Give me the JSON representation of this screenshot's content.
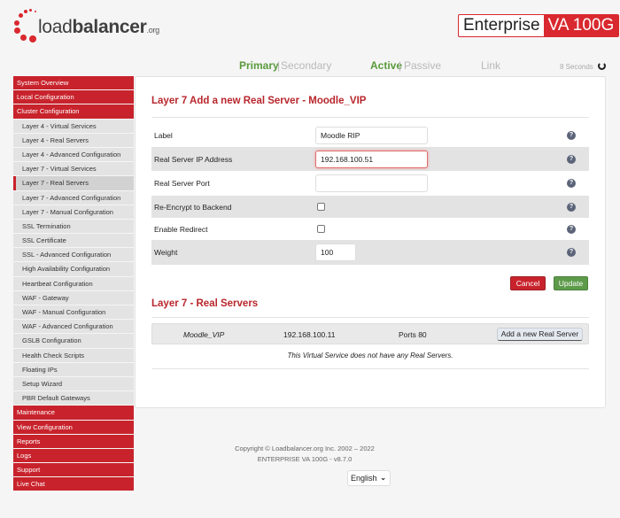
{
  "header": {
    "logo_text_light": "load",
    "logo_text_bold": "balancer",
    "logo_suffix": ".org",
    "edition_prefix": "Enterprise",
    "edition_model": "VA 100G",
    "brand_color": "#d9282f"
  },
  "status": {
    "primary": "Primary",
    "secondary": "Secondary",
    "active": "Active",
    "passive": "Passive",
    "link": "Link",
    "separator": "|",
    "refresh_interval": "8 Seconds"
  },
  "sidebar": {
    "items": [
      {
        "label": "System Overview",
        "type": "section"
      },
      {
        "label": "Local Configuration",
        "type": "section"
      },
      {
        "label": "Cluster Configuration",
        "type": "section"
      },
      {
        "label": "Layer 4 - Virtual Services",
        "type": "sub"
      },
      {
        "label": "Layer 4 - Real Servers",
        "type": "sub"
      },
      {
        "label": "Layer 4 - Advanced Configuration",
        "type": "sub"
      },
      {
        "label": "Layer 7 - Virtual Services",
        "type": "sub"
      },
      {
        "label": "Layer 7 - Real Servers",
        "type": "sub",
        "active": true
      },
      {
        "label": "Layer 7 - Advanced Configuration",
        "type": "sub"
      },
      {
        "label": "Layer 7 - Manual Configuration",
        "type": "sub"
      },
      {
        "label": "SSL Termination",
        "type": "sub"
      },
      {
        "label": "SSL Certificate",
        "type": "sub"
      },
      {
        "label": "SSL - Advanced Configuration",
        "type": "sub"
      },
      {
        "label": "High Availability Configuration",
        "type": "sub"
      },
      {
        "label": "Heartbeat Configuration",
        "type": "sub"
      },
      {
        "label": "WAF - Gateway",
        "type": "sub"
      },
      {
        "label": "WAF - Manual Configuration",
        "type": "sub"
      },
      {
        "label": "WAF - Advanced Configuration",
        "type": "sub"
      },
      {
        "label": "GSLB Configuration",
        "type": "sub"
      },
      {
        "label": "Health Check Scripts",
        "type": "sub"
      },
      {
        "label": "Floating IPs",
        "type": "sub"
      },
      {
        "label": "Setup Wizard",
        "type": "sub"
      },
      {
        "label": "PBR Default Gateways",
        "type": "sub"
      },
      {
        "label": "Maintenance",
        "type": "section"
      },
      {
        "label": "View Configuration",
        "type": "section"
      },
      {
        "label": "Reports",
        "type": "section"
      },
      {
        "label": "Logs",
        "type": "section"
      },
      {
        "label": "Support",
        "type": "section"
      },
      {
        "label": "Live Chat",
        "type": "section"
      }
    ]
  },
  "form": {
    "title": "Layer 7 Add a new Real Server - Moodle_VIP",
    "fields": {
      "label": {
        "label": "Label",
        "value": "Moodle RIP"
      },
      "ip": {
        "label": "Real Server IP Address",
        "value": "192.168.100.51"
      },
      "port": {
        "label": "Real Server Port",
        "value": ""
      },
      "reencrypt": {
        "label": "Re-Encrypt to Backend",
        "checked": false
      },
      "redirect": {
        "label": "Enable Redirect",
        "checked": false
      },
      "weight": {
        "label": "Weight",
        "value": "100"
      }
    },
    "help_glyph": "?",
    "cancel_label": "Cancel",
    "update_label": "Update"
  },
  "real_servers": {
    "title": "Layer 7 - Real Servers",
    "vip_name": "Moodle_VIP",
    "vip_ip": "192.168.100.11",
    "vip_ports": "Ports 80",
    "add_button": "Add a new Real Server",
    "empty_message": "This Virtual Service does not have any Real Servers."
  },
  "footer": {
    "copyright": "Copyright © Loadbalancer.org Inc. 2002 – 2022",
    "version": "ENTERPRISE VA 100G - v8.7.0",
    "language": "English"
  }
}
